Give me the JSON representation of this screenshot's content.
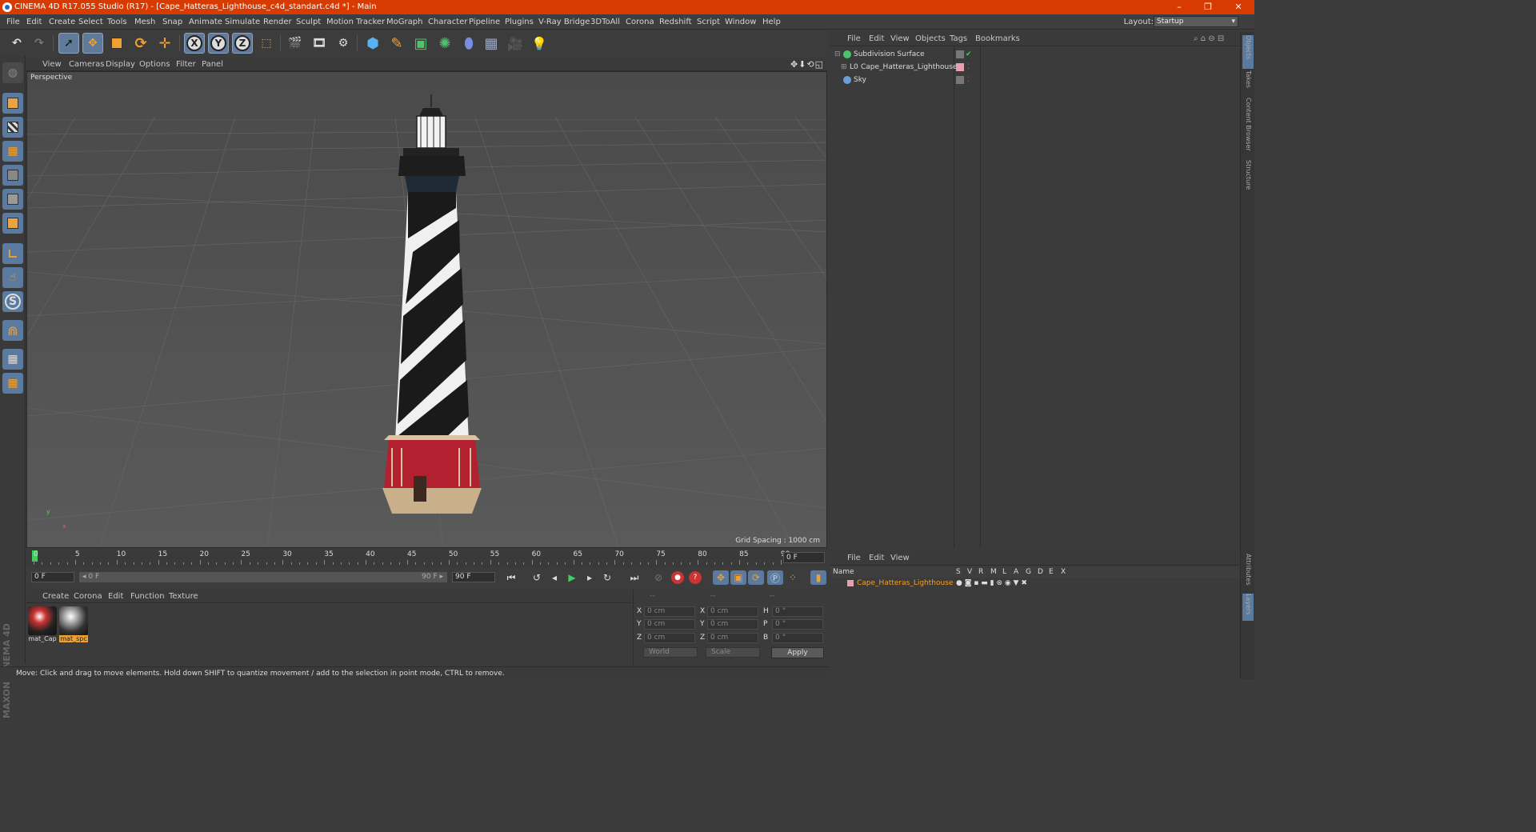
{
  "window": {
    "title": "CINEMA 4D R17.055 Studio (R17) - [Cape_Hatteras_Lighthouse_c4d_standart.c4d *] - Main",
    "minimize": "–",
    "maximize": "❐",
    "close": "✕"
  },
  "menubar": {
    "items": [
      "File",
      "Edit",
      "Create",
      "Select",
      "Tools",
      "Mesh",
      "Snap",
      "Animate",
      "Simulate",
      "Render",
      "Sculpt",
      "Motion Tracker",
      "MoGraph",
      "Character",
      "Pipeline",
      "Plugins",
      "V-Ray Bridge",
      "3DToAll",
      "Corona",
      "Redshift",
      "Script",
      "Window",
      "Help"
    ],
    "layout_label": "Layout:",
    "layout_value": "Startup"
  },
  "toolbar": {
    "axis_x": "X",
    "axis_y": "Y",
    "axis_z": "Z"
  },
  "viewport": {
    "menu": [
      "View",
      "Cameras",
      "Display",
      "Options",
      "Filter",
      "Panel"
    ],
    "camera_label": "Perspective",
    "grid_spacing": "Grid Spacing : 1000 cm",
    "nav_icons": "✥⬇⟲◱",
    "axis_y": "y",
    "axis_x": "x"
  },
  "timeline": {
    "ticks": [
      "0",
      "5",
      "10",
      "15",
      "20",
      "25",
      "30",
      "35",
      "40",
      "45",
      "50",
      "55",
      "60",
      "65",
      "70",
      "75",
      "80",
      "85",
      "90"
    ],
    "current_frame": "0 F",
    "start_frame": "0 F",
    "range_start": "◂ 0 F",
    "range_end": "90 F ▸",
    "end_frame": "90 F"
  },
  "materials": {
    "menu": [
      "Create",
      "Corona",
      "Edit",
      "Function",
      "Texture"
    ],
    "items": [
      {
        "label": "mat_Cap",
        "selected": false
      },
      {
        "label": "mat_spc",
        "selected": true
      }
    ]
  },
  "coordinates": {
    "header": [
      "--",
      "--",
      "--"
    ],
    "rows": [
      {
        "l1": "X",
        "v1": "0 cm",
        "l2": "X",
        "v2": "0 cm",
        "l3": "H",
        "v3": "0 °"
      },
      {
        "l1": "Y",
        "v1": "0 cm",
        "l2": "Y",
        "v2": "0 cm",
        "l3": "P",
        "v3": "0 °"
      },
      {
        "l1": "Z",
        "v1": "0 cm",
        "l2": "Z",
        "v2": "0 cm",
        "l3": "B",
        "v3": "0 °"
      }
    ],
    "mode": "World",
    "transform": "Scale",
    "apply": "Apply"
  },
  "status": {
    "text": "Move: Click and drag to move elements. Hold down SHIFT to quantize movement / add to the selection in point mode, CTRL to remove."
  },
  "objects": {
    "menu": [
      "File",
      "Edit",
      "View",
      "Objects",
      "Tags",
      "Bookmarks"
    ],
    "rows": [
      {
        "name": "Subdivision Surface",
        "indent": 0,
        "color": "#4cc46a"
      },
      {
        "name": "Cape_Hatteras_Lighthouse",
        "indent": 1,
        "color": "#d9d9d9"
      },
      {
        "name": "Sky",
        "indent": 0,
        "color": "#6a9fd8"
      }
    ]
  },
  "layers": {
    "menu": [
      "File",
      "Edit",
      "View"
    ],
    "columns": [
      "Name",
      "S",
      "V",
      "R",
      "M",
      "L",
      "A",
      "G",
      "D",
      "E",
      "X"
    ],
    "row_name": "Cape_Hatteras_Lighthouse"
  },
  "right_tabs": [
    "Objects",
    "Takes",
    "Content Browser",
    "Structure",
    "Attributes",
    "Layers"
  ],
  "logo_text": "MAXON CINEMA 4D",
  "colors": {
    "titlebar": "#d83b01",
    "selected_tool": "#607a99",
    "playhead": "#3ecf5d",
    "layer_name": "#f0a030"
  }
}
